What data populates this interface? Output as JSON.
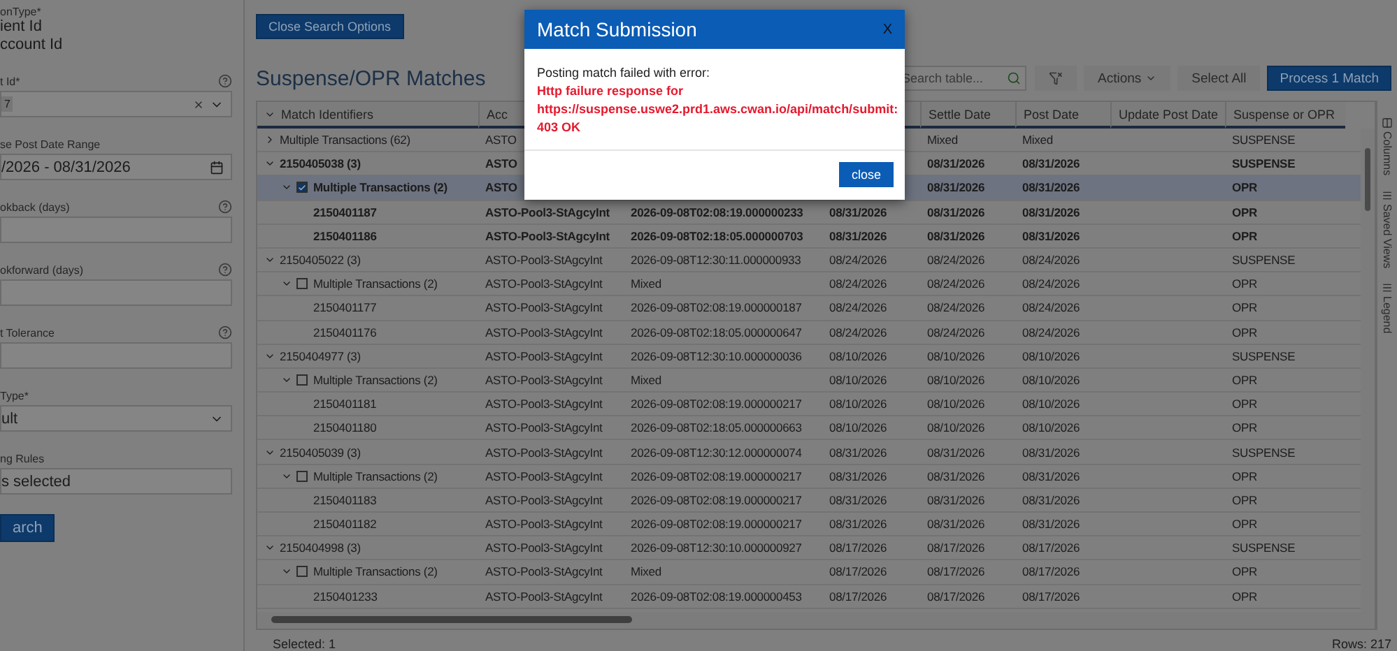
{
  "search_panel": {
    "title": "onType*",
    "options": [
      "ient Id",
      "ccount Id"
    ],
    "fields": [
      {
        "label": "t Id*",
        "kind": "select",
        "value": "7",
        "help": true,
        "clearable": true
      },
      {
        "label": "se Post Date Range",
        "kind": "date",
        "value": "/2026 - 08/31/2026",
        "help": false,
        "clearable": false
      },
      {
        "label": "okback (days)",
        "kind": "input",
        "help": true,
        "clearable": false
      },
      {
        "label": "okforward (days)",
        "kind": "input",
        "help": true,
        "clearable": false
      },
      {
        "label": "t Tolerance",
        "kind": "input",
        "help": true,
        "clearable": false
      },
      {
        "label": "Type*",
        "kind": "select",
        "value": "ult",
        "help": false,
        "clearable": false
      },
      {
        "label": "ng Rules",
        "kind": "text",
        "value": "s selected",
        "help": false,
        "clearable": false
      }
    ],
    "search_button": "arch"
  },
  "close_search_button": "Close Search Options",
  "title": "Suspense/OPR Matches",
  "toolbar": {
    "search": {
      "placeholder": "Search table..."
    },
    "actions": "Actions",
    "select_all": "Select All",
    "process": "Process 1 Match"
  },
  "table": {
    "columns": [
      "Match Identifiers",
      "Acc",
      null,
      null,
      "Settle Date",
      "Post Date",
      "Update Post Date",
      "Suspense or OPR"
    ],
    "rows": [
      {
        "id": "Multiple Transactions (62)",
        "account": "ASTO",
        "settle_date": "Mixed",
        "post_date": "Mixed",
        "suspense_or_opr": "SUSPENSE",
        "expanded": false,
        "selected": false,
        "emphasized": false
      },
      {
        "id": "2150405038 (3)",
        "account": "ASTO",
        "settle_date": "08/31/2026",
        "post_date": "08/31/2026",
        "suspense_or_opr": "SUSPENSE",
        "expanded": true,
        "selected": false,
        "emphasized": true,
        "children": [
          {
            "id": "Multiple Transactions (2)",
            "account": "ASTO",
            "settle_date": "08/31/2026",
            "post_date": "08/31/2026",
            "suspense_or_opr": "OPR",
            "expanded": true,
            "checked": true,
            "selected": true,
            "emphasized": true,
            "children": [
              {
                "id": "2150401187",
                "account": "ASTO-Pool3-StAgcyInt",
                "column_3": "2026-09-08T02:08:19.000000233",
                "column_4": "08/31/2026",
                "settle_date": "08/31/2026",
                "post_date": "08/31/2026",
                "suspense_or_opr": "OPR",
                "selected": false,
                "emphasized": true
              },
              {
                "id": "2150401186",
                "account": "ASTO-Pool3-StAgcyInt",
                "column_3": "2026-09-08T02:18:05.000000703",
                "column_4": "08/31/2026",
                "settle_date": "08/31/2026",
                "post_date": "08/31/2026",
                "suspense_or_opr": "OPR",
                "selected": false,
                "emphasized": true
              }
            ]
          }
        ]
      },
      {
        "id": "2150405022 (3)",
        "account": "ASTO-Pool3-StAgcyInt",
        "column_3": "2026-09-08T12:30:11.000000933",
        "column_4": "08/24/2026",
        "settle_date": "08/24/2026",
        "post_date": "08/24/2026",
        "suspense_or_opr": "SUSPENSE",
        "expanded": true,
        "selected": false,
        "emphasized": false,
        "children": [
          {
            "id": "Multiple Transactions (2)",
            "account": "ASTO-Pool3-StAgcyInt",
            "column_3": "Mixed",
            "column_4": "08/24/2026",
            "settle_date": "08/24/2026",
            "post_date": "08/24/2026",
            "suspense_or_opr": "OPR",
            "expanded": true,
            "checked": false,
            "selected": false,
            "emphasized": false,
            "children": [
              {
                "id": "2150401177",
                "account": "ASTO-Pool3-StAgcyInt",
                "column_3": "2026-09-08T02:08:19.000000187",
                "column_4": "08/24/2026",
                "settle_date": "08/24/2026",
                "post_date": "08/24/2026",
                "suspense_or_opr": "OPR",
                "selected": false,
                "emphasized": false
              },
              {
                "id": "2150401176",
                "account": "ASTO-Pool3-StAgcyInt",
                "column_3": "2026-09-08T02:18:05.000000647",
                "column_4": "08/24/2026",
                "settle_date": "08/24/2026",
                "post_date": "08/24/2026",
                "suspense_or_opr": "OPR",
                "selected": false,
                "emphasized": false
              }
            ]
          }
        ]
      },
      {
        "id": "2150404977 (3)",
        "account": "ASTO-Pool3-StAgcyInt",
        "column_3": "2026-09-08T12:30:10.000000036",
        "column_4": "08/10/2026",
        "settle_date": "08/10/2026",
        "post_date": "08/10/2026",
        "suspense_or_opr": "SUSPENSE",
        "expanded": true,
        "selected": false,
        "emphasized": false,
        "children": [
          {
            "id": "Multiple Transactions (2)",
            "account": "ASTO-Pool3-StAgcyInt",
            "column_3": "Mixed",
            "column_4": "08/10/2026",
            "settle_date": "08/10/2026",
            "post_date": "08/10/2026",
            "suspense_or_opr": "OPR",
            "expanded": true,
            "checked": false,
            "selected": false,
            "emphasized": false,
            "children": [
              {
                "id": "2150401181",
                "account": "ASTO-Pool3-StAgcyInt",
                "column_3": "2026-09-08T02:08:19.000000217",
                "column_4": "08/10/2026",
                "settle_date": "08/10/2026",
                "post_date": "08/10/2026",
                "suspense_or_opr": "OPR",
                "selected": false,
                "emphasized": false
              },
              {
                "id": "2150401180",
                "account": "ASTO-Pool3-StAgcyInt",
                "column_3": "2026-09-08T02:18:05.000000663",
                "column_4": "08/10/2026",
                "settle_date": "08/10/2026",
                "post_date": "08/10/2026",
                "suspense_or_opr": "OPR",
                "selected": false,
                "emphasized": false
              }
            ]
          }
        ]
      },
      {
        "id": "2150405039 (3)",
        "account": "ASTO-Pool3-StAgcyInt",
        "column_3": "2026-09-08T12:30:12.000000074",
        "column_4": "08/31/2026",
        "settle_date": "08/31/2026",
        "post_date": "08/31/2026",
        "suspense_or_opr": "SUSPENSE",
        "expanded": true,
        "selected": false,
        "emphasized": false,
        "children": [
          {
            "id": "Multiple Transactions (2)",
            "account": "ASTO-Pool3-StAgcyInt",
            "column_3": "2026-09-08T02:08:19.000000217",
            "column_4": "08/31/2026",
            "settle_date": "08/31/2026",
            "post_date": "08/31/2026",
            "suspense_or_opr": "OPR",
            "expanded": true,
            "checked": false,
            "selected": false,
            "emphasized": false,
            "children": [
              {
                "id": "2150401183",
                "account": "ASTO-Pool3-StAgcyInt",
                "column_3": "2026-09-08T02:08:19.000000217",
                "column_4": "08/31/2026",
                "settle_date": "08/31/2026",
                "post_date": "08/31/2026",
                "suspense_or_opr": "OPR",
                "selected": false,
                "emphasized": false
              },
              {
                "id": "2150401182",
                "account": "ASTO-Pool3-StAgcyInt",
                "column_3": "2026-09-08T02:08:19.000000217",
                "column_4": "08/31/2026",
                "settle_date": "08/31/2026",
                "post_date": "08/31/2026",
                "suspense_or_opr": "OPR",
                "selected": false,
                "emphasized": false
              }
            ]
          }
        ]
      },
      {
        "id": "2150404998 (3)",
        "account": "ASTO-Pool3-StAgcyInt",
        "column_3": "2026-09-08T12:30:10.000000927",
        "column_4": "08/17/2026",
        "settle_date": "08/17/2026",
        "post_date": "08/17/2026",
        "suspense_or_opr": "SUSPENSE",
        "expanded": true,
        "selected": false,
        "emphasized": false,
        "children": [
          {
            "id": "Multiple Transactions (2)",
            "account": "ASTO-Pool3-StAgcyInt",
            "column_3": "Mixed",
            "column_4": "08/17/2026",
            "settle_date": "08/17/2026",
            "post_date": "08/17/2026",
            "suspense_or_opr": "OPR",
            "expanded": true,
            "checked": false,
            "selected": false,
            "emphasized": false,
            "children": [
              {
                "id": "2150401233",
                "account": "ASTO-Pool3-StAgcyInt",
                "column_3": "2026-09-08T02:08:19.000000453",
                "column_4": "08/17/2026",
                "settle_date": "08/17/2026",
                "post_date": "08/17/2026",
                "suspense_or_opr": "OPR",
                "selected": false,
                "emphasized": false
              }
            ]
          }
        ]
      }
    ]
  },
  "side_panel": [
    "Columns",
    "Saved Views",
    "Legend"
  ],
  "footer": {
    "selected": "Selected: 1",
    "rows": "Rows: 217"
  },
  "dialog": {
    "title": "Match Submission",
    "close_glyph": "X",
    "message": "Posting match failed with error:",
    "error": "Http failure response for https://suspense.uswe2.prd1.aws.cwan.io/api/match/submit: 403 OK",
    "button": "close"
  }
}
